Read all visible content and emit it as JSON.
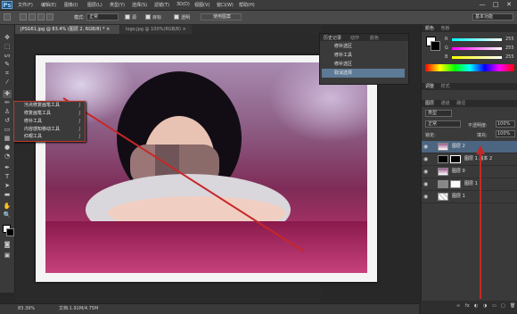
{
  "app": {
    "logo": "Ps"
  },
  "menu": [
    "文件(F)",
    "编辑(E)",
    "图像(I)",
    "图层(L)",
    "类型(Y)",
    "选择(S)",
    "滤镜(T)",
    "3D(D)",
    "视图(V)",
    "窗口(W)",
    "帮助(H)"
  ],
  "window_controls": {
    "minimize": "—",
    "maximize": "□",
    "close": "✕"
  },
  "options": {
    "feather_label": "羽化:",
    "mode_label": "模式:",
    "mode_value": "正常",
    "source_label": "源",
    "dest_label": "目标",
    "transparent_label": "透明",
    "use_pattern": "使用图案",
    "workspace": "基本功能"
  },
  "tabs": [
    {
      "label": "JPSG61.jpg @ 83.4% (图层 2, RGB/8) *",
      "close": "×"
    },
    {
      "label": "logo.jpg @ 100%(RGB/8)",
      "close": "×"
    }
  ],
  "context_menu": {
    "items": [
      {
        "label": "污点修复画笔工具",
        "shortcut": "J"
      },
      {
        "label": "修复画笔工具",
        "shortcut": "J"
      },
      {
        "label": "修补工具",
        "shortcut": "J"
      },
      {
        "label": "内容感知移动工具",
        "shortcut": "J"
      },
      {
        "label": "红眼工具",
        "shortcut": "J"
      }
    ]
  },
  "history_panel": {
    "tabs": [
      "历史记录",
      "动作",
      "颜色"
    ],
    "items": [
      "修补选区",
      "修补工具",
      "修补选区",
      "取消选择"
    ]
  },
  "color_panel": {
    "tabs": [
      "颜色",
      "色板"
    ],
    "channels": [
      {
        "name": "R",
        "value": "255"
      },
      {
        "name": "G",
        "value": "255"
      },
      {
        "name": "B",
        "value": "255"
      }
    ]
  },
  "adjust_panel": {
    "tabs": [
      "调整",
      "样式"
    ]
  },
  "layers_panel": {
    "tabs": [
      "图层",
      "通道",
      "路径"
    ],
    "kind_label": "类型",
    "blend_mode": "正常",
    "opacity_label": "不透明度:",
    "opacity_value": "100%",
    "lock_label": "锁定:",
    "fill_label": "填充:",
    "fill_value": "100%",
    "layers": [
      {
        "name": "图层 2",
        "selected": true
      },
      {
        "name": "图层 1 副本 2",
        "selected": false
      },
      {
        "name": "图层 0",
        "selected": false
      },
      {
        "name": "图层 1",
        "selected": false
      },
      {
        "name": "图层 1",
        "selected": false
      }
    ],
    "footer_icons": [
      "link-icon",
      "fx-icon",
      "mask-icon",
      "adjustment-icon",
      "folder-icon",
      "new-layer-icon",
      "trash-icon"
    ]
  },
  "status": {
    "zoom": "83.39%",
    "doc_label": "文档:1.91M/4.75M"
  },
  "colors": {
    "accent_red": "#c62828",
    "selected_layer": "#4c6580"
  }
}
